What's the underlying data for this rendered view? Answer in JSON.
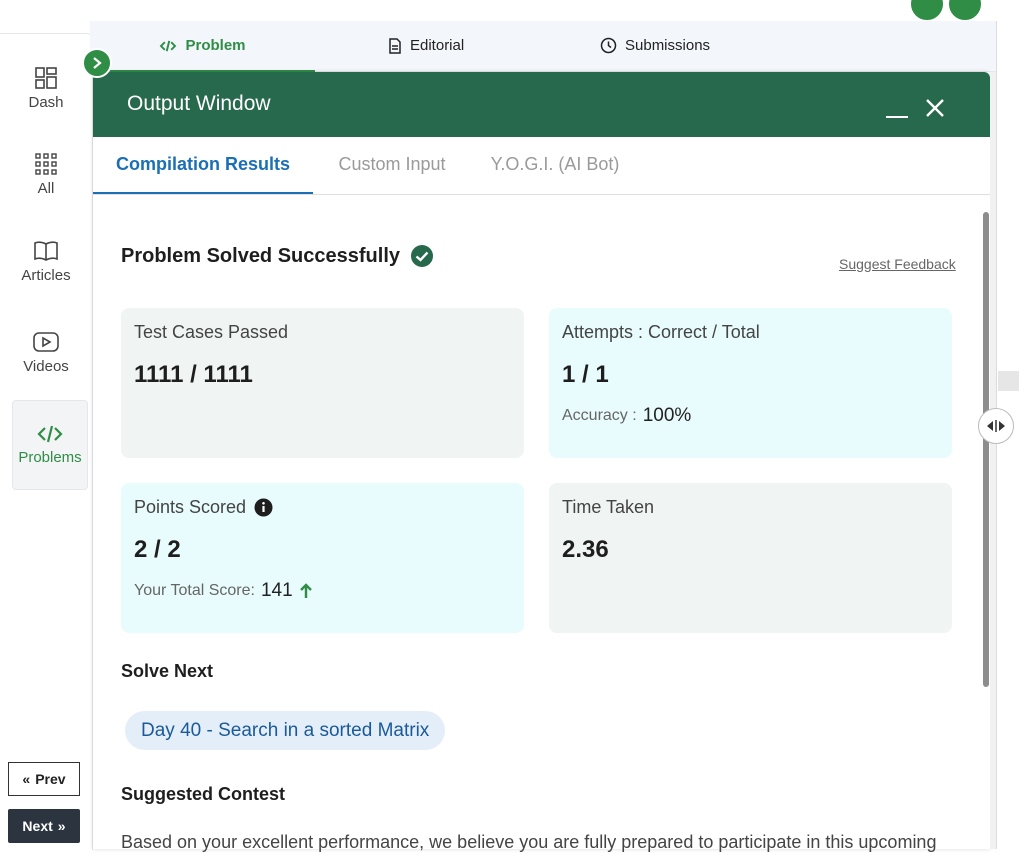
{
  "sidebar": {
    "items": [
      {
        "label": "Dash",
        "icon": "dashboard-icon"
      },
      {
        "label": "All",
        "icon": "grid-icon"
      },
      {
        "label": "Articles",
        "icon": "book-icon"
      },
      {
        "label": "Videos",
        "icon": "video-icon"
      },
      {
        "label": "Problems",
        "icon": "code-icon"
      }
    ],
    "prev_label": "Prev",
    "next_label": "Next"
  },
  "problem_tabs": [
    {
      "label": "Problem",
      "icon": "code-icon"
    },
    {
      "label": "Editorial",
      "icon": "document-icon"
    },
    {
      "label": "Submissions",
      "icon": "clock-icon"
    }
  ],
  "output_window": {
    "title": "Output Window",
    "tabs": [
      "Compilation Results",
      "Custom Input",
      "Y.O.G.I. (AI Bot)"
    ],
    "status": "Problem Solved Successfully",
    "suggest_feedback": "Suggest Feedback",
    "cards": {
      "test_cases": {
        "label": "Test Cases Passed",
        "value": "1111 / 1111"
      },
      "attempts": {
        "label": "Attempts : Correct / Total",
        "value": "1 / 1",
        "sub_label": "Accuracy :",
        "sub_value": "100%"
      },
      "points": {
        "label": "Points Scored",
        "value": "2 / 2",
        "sub_label": "Your Total Score:",
        "sub_value": "141"
      },
      "time": {
        "label": "Time Taken",
        "value": "2.36"
      }
    },
    "solve_next_heading": "Solve Next",
    "solve_next_link": "Day 40 - Search in a sorted Matrix",
    "contest_heading": "Suggested Contest",
    "contest_text": "Based on your excellent performance, we believe you are fully prepared to participate in this upcoming"
  },
  "colors": {
    "brand_green": "#2f8d46",
    "header_green": "#27694d",
    "tab_blue": "#1a6fb5"
  }
}
